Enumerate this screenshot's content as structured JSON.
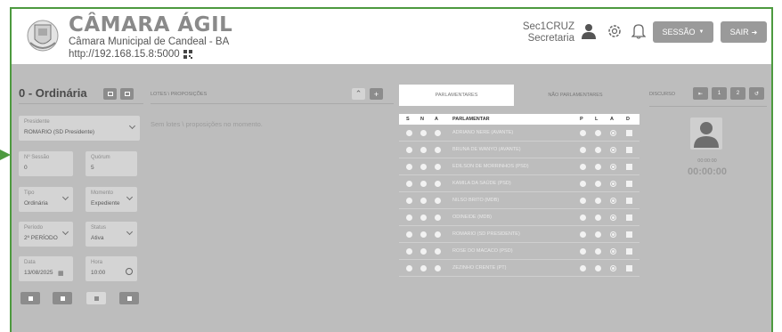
{
  "header": {
    "title": "CÂMARA ÁGIL",
    "subtitle": "Câmara Municipal de Candeal - BA",
    "url": "http://192.168.15.8:5000",
    "user_name": "Sec1CRUZ",
    "user_role": "Secretaria",
    "session_button": "SESSÃO",
    "exit_button": "SAIR"
  },
  "session": {
    "title": "0 - Ordinária",
    "fields": {
      "presidente": {
        "label": "Presidente",
        "value": "ROMARIO (SD Presidente)"
      },
      "numero": {
        "label": "Nº Sessão",
        "value": "0"
      },
      "quorum": {
        "label": "Quórum",
        "value": "5"
      },
      "tipo": {
        "label": "Tipo",
        "value": "Ordinária"
      },
      "momento": {
        "label": "Momento",
        "value": "Expediente"
      },
      "periodo": {
        "label": "Período",
        "value": "2º PERÍODO"
      },
      "status": {
        "label": "Status",
        "value": "Ativa"
      },
      "data": {
        "label": "Data",
        "value": "13/08/2025"
      },
      "hora": {
        "label": "Hora",
        "value": "10:00"
      }
    }
  },
  "lotes": {
    "header": "LOTES \\ PROPOSIÇÕES",
    "empty": "Sem lotes \\ proposições no momento."
  },
  "tabs": {
    "parlamentares": "PARLAMENTARES",
    "nao_parlamentares": "NÃO PARLAMENTARES"
  },
  "table": {
    "headers": {
      "s": "S",
      "n": "N",
      "a": "A",
      "name": "PARLAMENTAR",
      "p": "P",
      "l": "L",
      "a2": "A",
      "d": "D"
    },
    "rows": [
      "ADRIANO NERE (AVANTE)",
      "BRUNA DE WANYO (AVANTE)",
      "EDILSON DE MORRINHOS (PSD)",
      "KAMILA DA SAÚDE (PSD)",
      "NILSO BRITO (MDB)",
      "ODINEIDE (MDB)",
      "ROMARIO (SD PRESIDENTE)",
      "ROSE DO MACACO (PSD)",
      "ZEZINHO CRENTE (PT)"
    ]
  },
  "discurso": {
    "label": "DISCURSO",
    "buttons": [
      "1",
      "2"
    ],
    "timer_small": "00:00:00",
    "timer_big": "00:00:00"
  },
  "colors": {
    "accent_border": "#4d9a3f",
    "panel": "#bdbdbd",
    "button": "#9a9a9a"
  }
}
